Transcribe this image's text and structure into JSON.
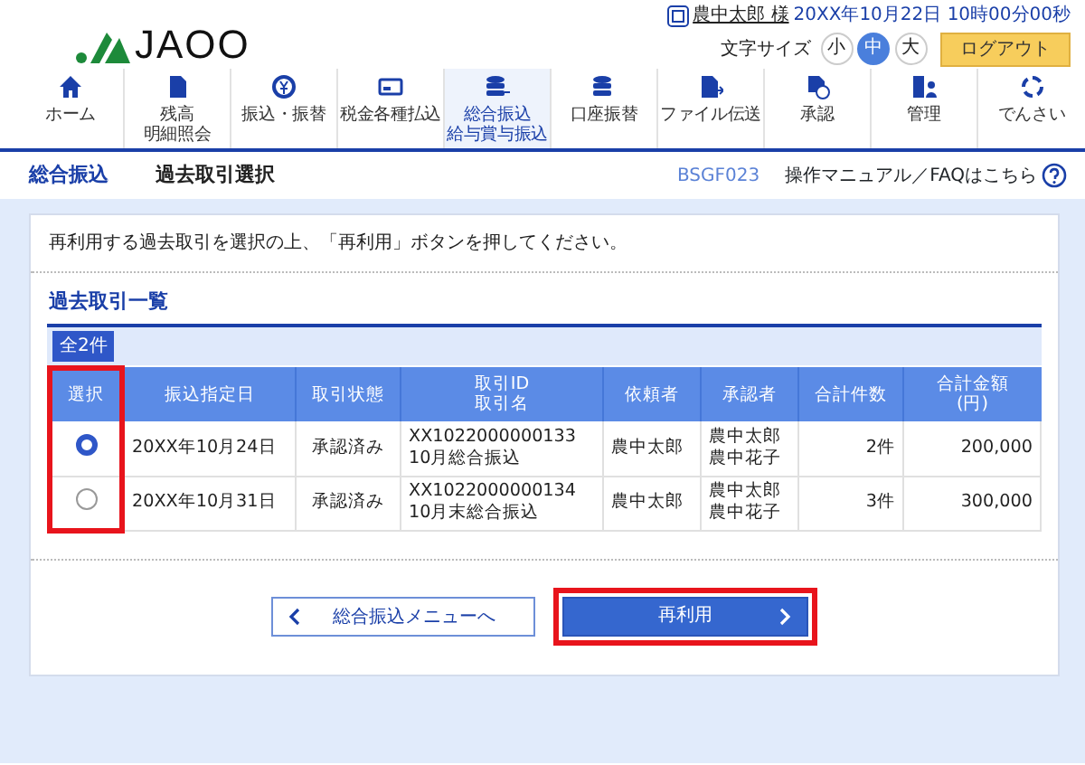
{
  "header": {
    "logo": "JAOO",
    "user": {
      "name": "農中太郎 様",
      "datetime": "20XX年10月22日 10時00分00秒"
    },
    "font_size": {
      "label": "文字サイズ",
      "options": [
        {
          "label": "小",
          "selected": false
        },
        {
          "label": "中",
          "selected": true
        },
        {
          "label": "大",
          "selected": false
        }
      ]
    },
    "logout": "ログアウト"
  },
  "nav": [
    {
      "lines": [
        "ホーム"
      ],
      "selected": false
    },
    {
      "lines": [
        "残高",
        "明細照会"
      ],
      "selected": false
    },
    {
      "lines": [
        "振込・振替"
      ],
      "selected": false
    },
    {
      "lines": [
        "税金各種払込"
      ],
      "selected": false
    },
    {
      "lines": [
        "総合振込",
        "給与賞与振込"
      ],
      "selected": true
    },
    {
      "lines": [
        "口座振替"
      ],
      "selected": false
    },
    {
      "lines": [
        "ファイル伝送"
      ],
      "selected": false
    },
    {
      "lines": [
        "承認"
      ],
      "selected": false
    },
    {
      "lines": [
        "管理"
      ],
      "selected": false
    },
    {
      "lines": [
        "でんさい"
      ],
      "selected": false
    }
  ],
  "title_bar": {
    "category": "総合振込",
    "title": "過去取引選択",
    "screen_id": "BSGF023",
    "help": "操作マニュアル／FAQはこちら"
  },
  "instruction": "再利用する過去取引を選択の上、「再利用」ボタンを押してください。",
  "section_title": "過去取引一覧",
  "table": {
    "count": "全2件",
    "columns": [
      {
        "lines": [
          "選択"
        ],
        "highlighted": true
      },
      {
        "lines": [
          "振込指定日"
        ],
        "highlighted": false
      },
      {
        "lines": [
          "取引状態"
        ],
        "highlighted": false
      },
      {
        "lines": [
          "取引ID",
          "取引名"
        ],
        "highlighted": false
      },
      {
        "lines": [
          "依頼者"
        ],
        "highlighted": false
      },
      {
        "lines": [
          "承認者"
        ],
        "highlighted": false
      },
      {
        "lines": [
          "合計件数"
        ],
        "highlighted": false
      },
      {
        "lines": [
          "合計金額",
          "(円)"
        ],
        "highlighted": false
      }
    ],
    "rows": [
      {
        "selected": true,
        "date": "20XX年10月24日",
        "status": "承認済み",
        "id": "XX1022000000133",
        "name": "10月総合振込",
        "requester": "農中太郎",
        "approvers": [
          "農中太郎",
          "農中花子"
        ],
        "count": "2件",
        "amount": "200,000"
      },
      {
        "selected": false,
        "date": "20XX年10月31日",
        "status": "承認済み",
        "id": "XX1022000000134",
        "name": "10月末総合振込",
        "requester": "農中太郎",
        "approvers": [
          "農中太郎",
          "農中花子"
        ],
        "count": "3件",
        "amount": "300,000"
      }
    ]
  },
  "buttons": {
    "back": {
      "label": "総合振込メニューへ"
    },
    "reuse": {
      "label": "再利用",
      "highlighted": true
    }
  }
}
